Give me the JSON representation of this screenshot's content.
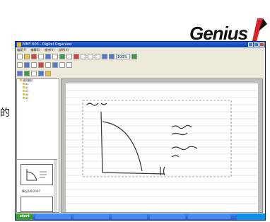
{
  "logo": {
    "text": "Genius"
  },
  "caption": {
    "text": "的"
  },
  "window": {
    "title": "MMY 603 - Digital Organizer"
  },
  "menu": [
    "檔案(F)",
    "編輯(E)",
    "檢視(V)",
    "說明(H)"
  ],
  "toolbar": {
    "zoom_value": "100%"
  },
  "tree": {
    "root": "我的筆記",
    "items": [
      "a1",
      "a2",
      "a3",
      "a4",
      "a5"
    ]
  },
  "thumbnail": {
    "label": "筆記1/6/2007"
  },
  "taskbar": {
    "start_label": "start"
  },
  "colors": {
    "titlebar": "#0a3fb0",
    "taskbar": "#1f5bd0",
    "start": "#3a9d3a",
    "logo_swoosh": "#d8232a"
  }
}
